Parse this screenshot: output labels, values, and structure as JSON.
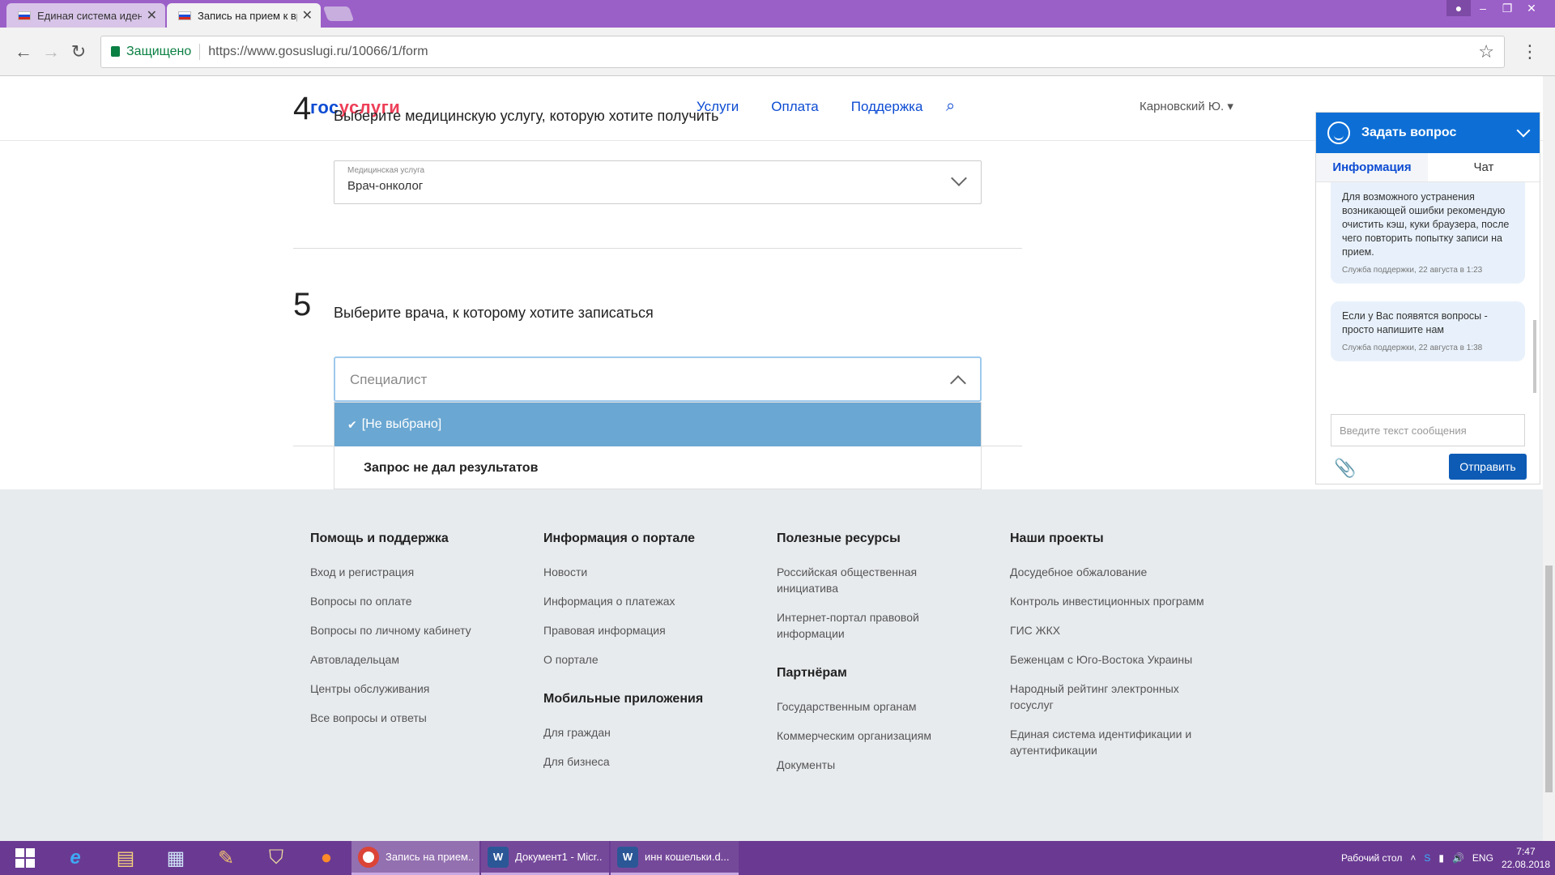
{
  "browser": {
    "tabs": [
      {
        "title": "Единая система идентиф",
        "active": false
      },
      {
        "title": "Запись на прием к врач",
        "active": true
      }
    ],
    "secure_label": "Защищено",
    "url": "https://www.gosuslugi.ru/10066/1/form"
  },
  "header": {
    "logo_part1": "гос",
    "logo_part2": "услуги",
    "nav": [
      "Услуги",
      "Оплата",
      "Поддержка"
    ],
    "user": "Карновский Ю. ▾"
  },
  "step4": {
    "number": "4",
    "title": "Выберите медицинскую услугу, которую хотите получить",
    "field_label": "Медицинская услуга",
    "field_value": "Врач-онколог"
  },
  "step5": {
    "number": "5",
    "title": "Выберите врача, к которому хотите записаться",
    "placeholder": "Специалист",
    "options": [
      {
        "label": "[Не выбрано]",
        "selected": true
      },
      {
        "label": "Запрос не дал результатов",
        "selected": false
      }
    ]
  },
  "chat": {
    "title": "Задать вопрос",
    "tabs": [
      "Информация",
      "Чат"
    ],
    "messages": [
      {
        "text": "Для возможного устранения возникающей ошибки рекомендую очистить кэш, куки браузера, после чего повторить попытку записи на прием.",
        "meta": "Служба поддержки, 22 августа в 1:23"
      },
      {
        "text": "Если у Вас появятся вопросы - просто напишите нам",
        "meta": "Служба поддержки, 22 августа в 1:38"
      }
    ],
    "input_placeholder": "Введите текст сообщения",
    "send_label": "Отправить"
  },
  "footer": {
    "col1": {
      "title": "Помощь и поддержка",
      "links": [
        "Вход и регистрация",
        "Вопросы по оплате",
        "Вопросы по личному кабинету",
        "Автовладельцам",
        "Центры обслуживания",
        "Все вопросы и ответы"
      ]
    },
    "col2": {
      "title": "Информация о портале",
      "links": [
        "Новости",
        "Информация о платежах",
        "Правовая информация",
        "О портале"
      ],
      "sub_title": "Мобильные приложения",
      "sub_links": [
        "Для граждан",
        "Для бизнеса"
      ]
    },
    "col3": {
      "title": "Полезные ресурсы",
      "links": [
        "Российская общественная инициатива",
        "Интернет-портал правовой информации"
      ],
      "sub_title": "Партнёрам",
      "sub_links": [
        "Государственным органам",
        "Коммерческим организациям",
        "Документы"
      ]
    },
    "col4": {
      "title": "Наши проекты",
      "links": [
        "Досудебное обжалование",
        "Контроль инвестиционных программ",
        "ГИС ЖКХ",
        "Беженцам с Юго-Востока Украины",
        "Народный рейтинг электронных госуслуг",
        "Единая система идентификации и аутентификации"
      ]
    }
  },
  "taskbar": {
    "tasks": [
      {
        "label": "Запись на прием...",
        "active": true
      },
      {
        "label": "Документ1 - Micr...",
        "active": false
      },
      {
        "label": "инн кошельки.d...",
        "active": false
      }
    ],
    "desktop_label": "Рабочий стол",
    "lang": "ENG",
    "time": "7:47",
    "date": "22.08.2018"
  },
  "colors": {
    "brand_blue": "#0d4cd3",
    "brand_red": "#ee3f58",
    "selected_option": "#6aa7d2",
    "chat_header": "#0d6fd6",
    "taskbar": "#6a3a92"
  }
}
